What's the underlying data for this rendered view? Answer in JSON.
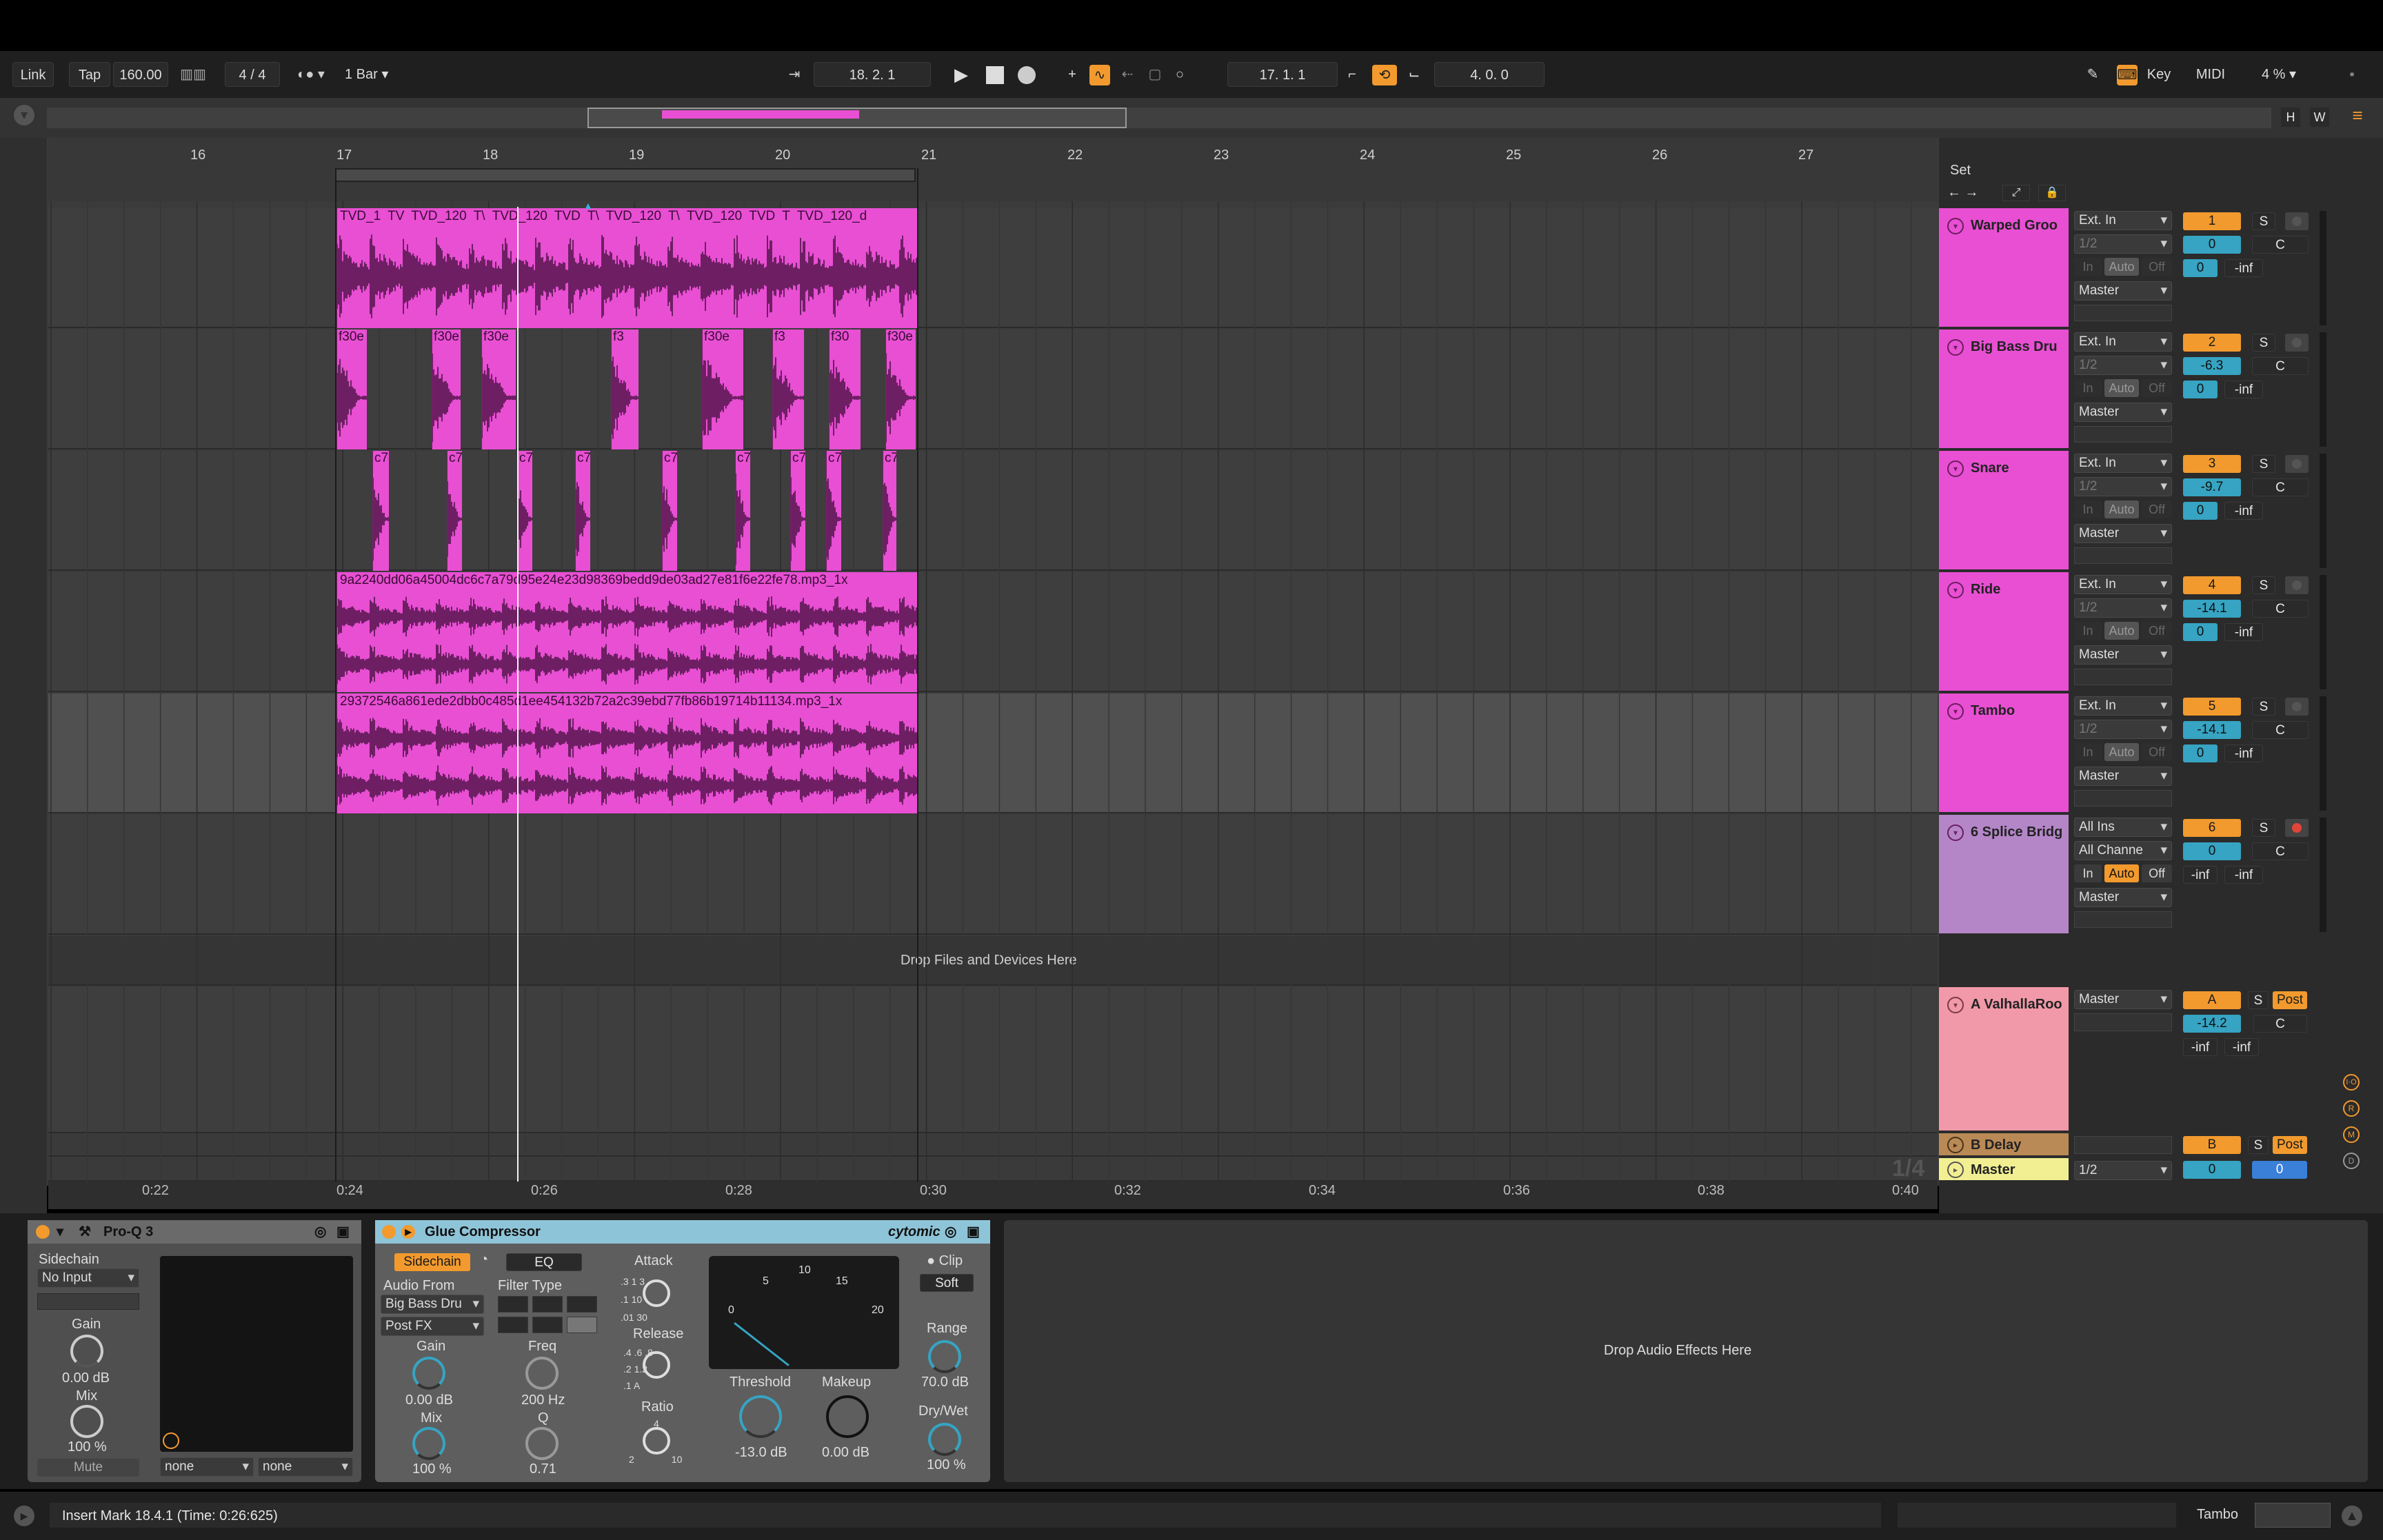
{
  "colors": {
    "clip": "#e84fd3",
    "orange": "#f29a2e",
    "blue": "#36a4c2",
    "return_a": "#f199a9",
    "return_b": "#b98a56",
    "master": "#f1ef92",
    "midi_track": "#b486c8"
  },
  "toolbar": {
    "link": "Link",
    "tap": "Tap",
    "tempo": "160.00",
    "signature": "4 / 4",
    "quantize": "1 Bar",
    "position": "18. 2. 1",
    "loop_start": "17. 1. 1",
    "loop_length": "4. 0. 0",
    "key": "Key",
    "midi": "MIDI",
    "cpu": "4 %"
  },
  "overview": {
    "h": "H",
    "w": "W"
  },
  "ruler": {
    "bars": [
      "16",
      "17",
      "18",
      "19",
      "20",
      "21",
      "22",
      "23",
      "24",
      "25",
      "26",
      "27"
    ]
  },
  "timeline": {
    "times": [
      "0:22",
      "0:24",
      "0:26",
      "0:28",
      "0:30",
      "0:32",
      "0:34",
      "0:36",
      "0:38",
      "0:40"
    ],
    "page": "1/4"
  },
  "arrangement": {
    "drop_text": "Drop Files and Devices Here",
    "lane1_labels": [
      "TVD_1",
      "TV",
      "TVD_120",
      "T\\",
      "TVD_120",
      "TVD",
      "T\\",
      "TVD_120",
      "T\\",
      "TVD_120",
      "TVD",
      "T",
      "TVD_120_d"
    ],
    "lane2_labels": [
      "f30e",
      "f30e",
      "f30e",
      "f3",
      "f30e",
      "f3",
      "f30",
      "f30e",
      "f30e",
      "f30e"
    ],
    "lane3_labels": [
      "c7",
      "c7",
      "c7",
      "c7",
      "c7",
      "c7",
      "c7",
      "c7",
      "c7",
      "c7"
    ],
    "lane4_label": "9a2240dd06a45004dc6c7a79d95e24e23d98369bedd9de03ad27e81f6e22fe78.mp3_1x",
    "lane5_label": "29372546a861ede2dbb0c485d1ee454132b72a2c39ebd77fb86b19714b11134.mp3_1x"
  },
  "mixer": {
    "set_label": "Set",
    "tracks": [
      {
        "name": "Warped Groo",
        "input": "Ext. In",
        "channel": "1/2",
        "in": "In",
        "auto": "Auto",
        "off": "Off",
        "output": "Master",
        "number": "1",
        "solo": "S",
        "volume": "0",
        "pan": "C",
        "send": "0",
        "send_b": "-inf"
      },
      {
        "name": "Big Bass Dru",
        "input": "Ext. In",
        "channel": "1/2",
        "in": "In",
        "auto": "Auto",
        "off": "Off",
        "output": "Master",
        "number": "2",
        "solo": "S",
        "volume": "-6.3",
        "pan": "C",
        "send": "0",
        "send_b": "-inf"
      },
      {
        "name": "Snare",
        "input": "Ext. In",
        "channel": "1/2",
        "in": "In",
        "auto": "Auto",
        "off": "Off",
        "output": "Master",
        "number": "3",
        "solo": "S",
        "volume": "-9.7",
        "pan": "C",
        "send": "0",
        "send_b": "-inf"
      },
      {
        "name": "Ride",
        "input": "Ext. In",
        "channel": "1/2",
        "in": "In",
        "auto": "Auto",
        "off": "Off",
        "output": "Master",
        "number": "4",
        "solo": "S",
        "volume": "-14.1",
        "pan": "C",
        "send": "0",
        "send_b": "-inf"
      },
      {
        "name": "Tambo",
        "input": "Ext. In",
        "channel": "1/2",
        "in": "In",
        "auto": "Auto",
        "off": "Off",
        "output": "Master",
        "number": "5",
        "solo": "S",
        "volume": "-14.1",
        "pan": "C",
        "send": "0",
        "send_b": "-inf"
      },
      {
        "name": "6 Splice Bridg",
        "input": "All Ins",
        "channel": "All Channe",
        "in": "In",
        "auto": "Auto",
        "off": "Off",
        "output": "Master",
        "number": "6",
        "solo": "S",
        "volume": "0",
        "pan": "C",
        "send": "-inf",
        "send_b": "-inf"
      }
    ],
    "return_a": {
      "name": "A ValhallaRoo",
      "output": "Master",
      "number": "A",
      "solo": "S",
      "post": "Post",
      "volume": "-14.2",
      "pan": "C",
      "send": "-inf",
      "send_b": "-inf"
    },
    "return_b": {
      "name": "B Delay",
      "number": "B",
      "solo": "S",
      "post": "Post"
    },
    "master": {
      "name": "Master",
      "channel": "1/2",
      "cue": "0",
      "volume": "0"
    }
  },
  "devices": {
    "proq": {
      "title": "Pro-Q 3",
      "sidechain": "Sidechain",
      "input": "No Input",
      "gain_label": "Gain",
      "gain": "0.00 dB",
      "mix_label": "Mix",
      "mix": "100 %",
      "mute": "Mute",
      "none1": "none",
      "none2": "none"
    },
    "glue": {
      "title": "Glue Compressor",
      "brand": "cytomic",
      "sidechain": "Sidechain",
      "eq": "EQ",
      "audio_from": "Audio From",
      "source": "Big Bass Dru",
      "tap": "Post FX",
      "filter_type": "Filter Type",
      "gain_label": "Gain",
      "gain": "0.00 dB",
      "freq_label": "Freq",
      "freq": "200 Hz",
      "mix_label": "Mix",
      "mix": "100 %",
      "q_label": "Q",
      "q": "0.71",
      "attack": "Attack",
      "release": "Release",
      "ratio": "Ratio",
      "threshold_label": "Threshold",
      "threshold": "-13.0 dB",
      "makeup_label": "Makeup",
      "makeup": "0.00 dB",
      "clip": "Clip",
      "soft": "Soft",
      "range_label": "Range",
      "range": "70.0 dB",
      "drywet_label": "Dry/Wet",
      "drywet": "100 %",
      "meter": [
        "0",
        "5",
        "10",
        "15",
        "20"
      ],
      "attack_ticks": [
        ".3",
        "1",
        "3",
        ".1",
        "10",
        ".01",
        "30"
      ],
      "release_ticks": [
        ".4",
        ".6",
        ".8",
        ".2",
        "1.2",
        ".1",
        "A"
      ],
      "ratio_ticks": [
        "4",
        "2",
        "10"
      ]
    },
    "drop_effects": "Drop Audio Effects Here"
  },
  "status": {
    "message": "Insert Mark 18.4.1 (Time: 0:26:625)",
    "track": "Tambo"
  }
}
